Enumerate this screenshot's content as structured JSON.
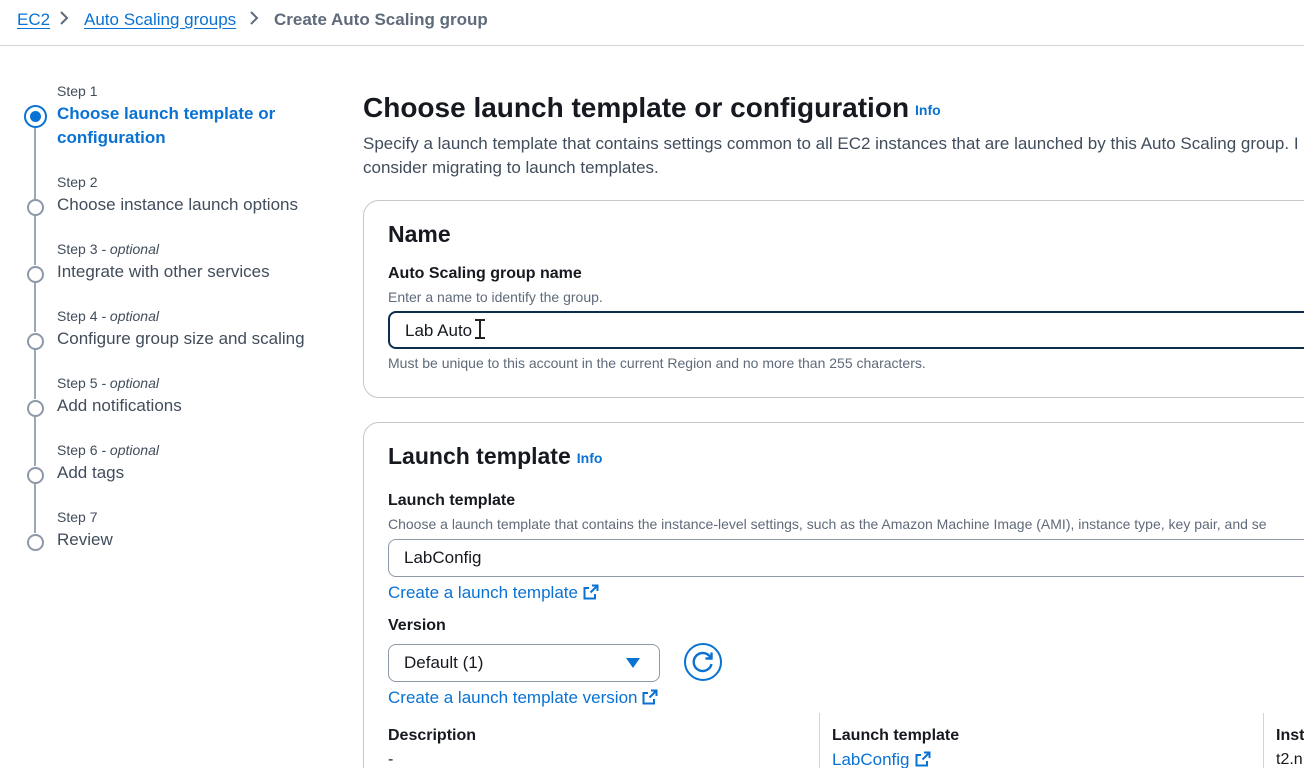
{
  "breadcrumb": {
    "items": [
      "EC2",
      "Auto Scaling groups"
    ],
    "current": "Create Auto Scaling group"
  },
  "steps": [
    {
      "num": "Step 1",
      "optional": "",
      "title": "Choose launch template or configuration"
    },
    {
      "num": "Step 2",
      "optional": "",
      "title": "Choose instance launch options"
    },
    {
      "num": "Step 3",
      "optional": " - optional",
      "title": "Integrate with other services"
    },
    {
      "num": "Step 4",
      "optional": " - optional",
      "title": "Configure group size and scaling"
    },
    {
      "num": "Step 5",
      "optional": " - optional",
      "title": "Add notifications"
    },
    {
      "num": "Step 6",
      "optional": " - optional",
      "title": "Add tags"
    },
    {
      "num": "Step 7",
      "optional": "",
      "title": "Review"
    }
  ],
  "page": {
    "title": "Choose launch template or configuration",
    "info": "Info",
    "description": "Specify a launch template that contains settings common to all EC2 instances that are launched by this Auto Scaling group. I",
    "description_line2": "consider migrating to launch templates."
  },
  "name_panel": {
    "title": "Name",
    "field_label": "Auto Scaling group name",
    "field_hint": "Enter a name to identify the group.",
    "field_value": "Lab Auto",
    "constraint": "Must be unique to this account in the current Region and no more than 255 characters."
  },
  "launch_panel": {
    "title": "Launch template",
    "info": "Info",
    "field_label": "Launch template",
    "field_hint": "Choose a launch template that contains the instance-level settings, such as the Amazon Machine Image (AMI), instance type, key pair, and se",
    "field_value": "LabConfig",
    "create_link": "Create a launch template",
    "version_label": "Version",
    "version_value": "Default (1)",
    "create_version_link": "Create a launch template version",
    "details": {
      "description_label": "Description",
      "description_value": "-",
      "template_label": "Launch template",
      "template_value": "LabConfig",
      "instance_label": "Inst",
      "instance_value": "t2.n"
    }
  },
  "colors": {
    "link": "#0972d3",
    "text": "#16191f",
    "muted": "#5f6b7a",
    "focus_border": "#0b2e4f"
  },
  "icons": [
    "chevron-right-icon",
    "external-link-icon",
    "refresh-icon",
    "caret-down-icon",
    "text-cursor-icon"
  ]
}
